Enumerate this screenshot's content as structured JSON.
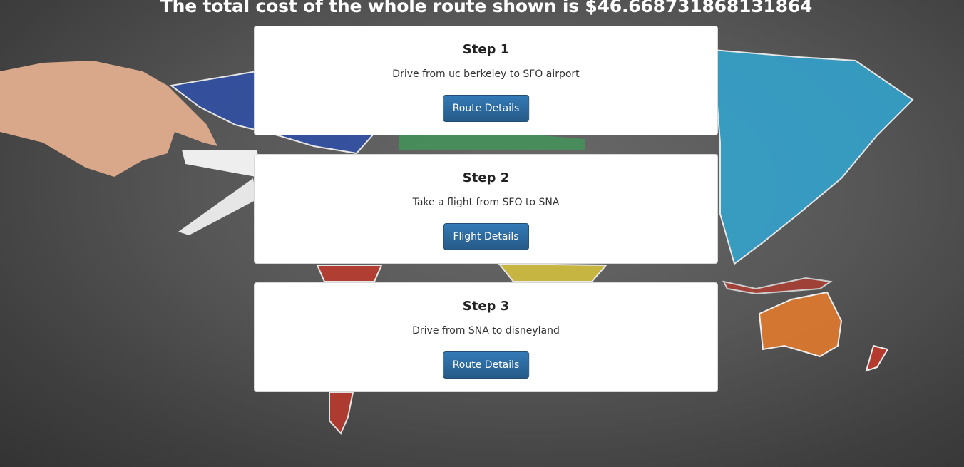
{
  "header": {
    "total_cost_text": "The total cost of the whole route shown is $46.668731868131864"
  },
  "steps": [
    {
      "title": "Step 1",
      "description": "Drive from uc berkeley to SFO airport",
      "button_label": "Route Details"
    },
    {
      "title": "Step 2",
      "description": "Take a flight from SFO to SNA",
      "button_label": "Flight Details"
    },
    {
      "title": "Step 3",
      "description": "Drive from SNA to disneyland",
      "button_label": "Route Details"
    }
  ],
  "colors": {
    "button_primary": "#2a6496",
    "card_background": "#ffffff",
    "page_background": "#555555"
  },
  "background_image": {
    "subject": "chalkboard-world-map-with-toy-airplane"
  }
}
